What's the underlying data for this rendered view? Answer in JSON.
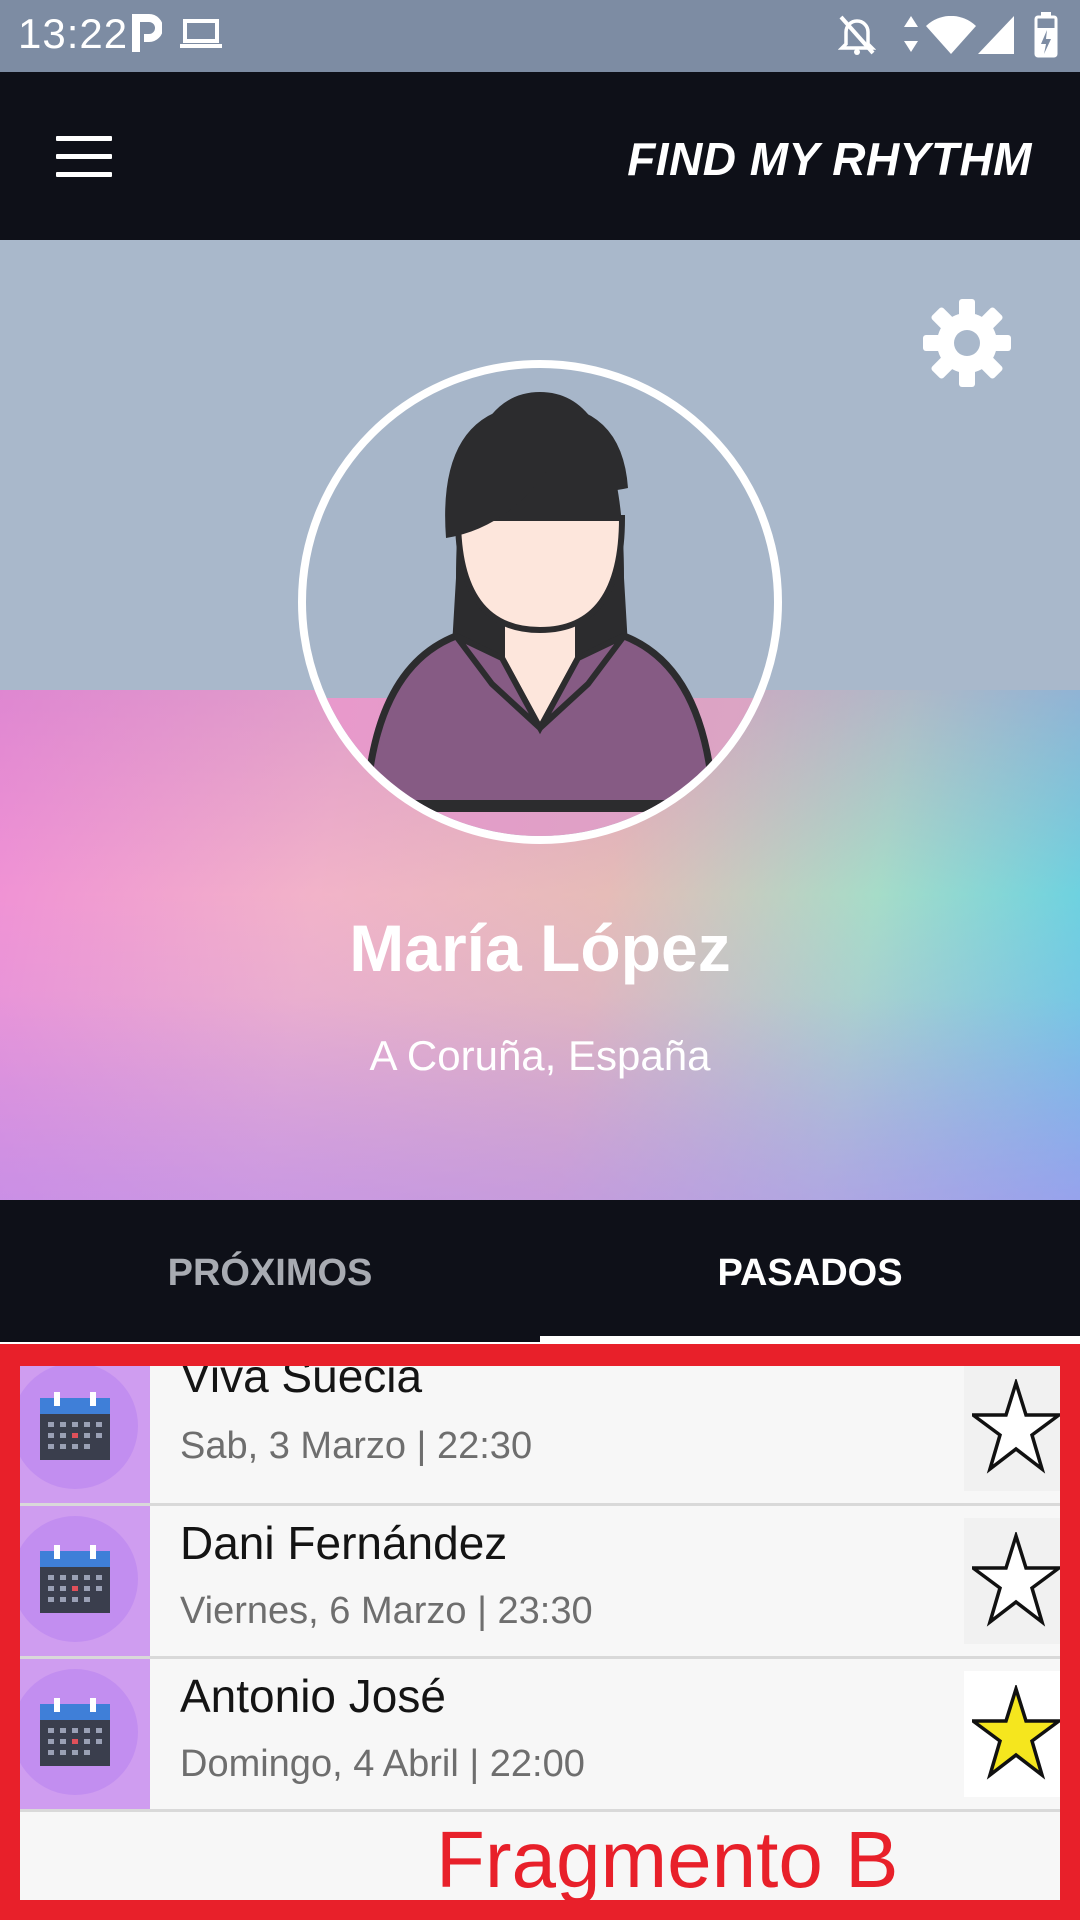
{
  "status_bar": {
    "time": "13:22",
    "icons": [
      "parking-icon",
      "laptop-icon",
      "notifications-off-icon",
      "data-arrows-icon",
      "wifi-icon",
      "signal-icon",
      "battery-icon"
    ],
    "color": "#7d8ca3"
  },
  "app_bar": {
    "title": "FIND MY RHYTHM",
    "menu_icon": "hamburger-menu-icon"
  },
  "profile": {
    "name": "María López",
    "location": "A Coruña, España",
    "settings_icon": "gear-icon",
    "avatar_icon": "woman-avatar-icon"
  },
  "tabs": [
    {
      "label": "PRÓXIMOS",
      "selected": false
    },
    {
      "label": "PASADOS",
      "selected": true
    }
  ],
  "events": [
    {
      "title": "Viva Suecia",
      "date": "Sab, 3 Marzo | 22:30",
      "favorite": false
    },
    {
      "title": "Dani Fernández",
      "date": "Viernes, 6 Marzo | 23:30",
      "favorite": false
    },
    {
      "title": "Antonio José",
      "date": "Domingo, 4 Abril | 22:00",
      "favorite": true
    }
  ],
  "annotation": {
    "label": "Fragmento B",
    "color": "#e8202a"
  },
  "colors": {
    "appbar": "#0e1018",
    "star_filled": "#f5e61e",
    "icon_accent": "#cf9df0"
  }
}
